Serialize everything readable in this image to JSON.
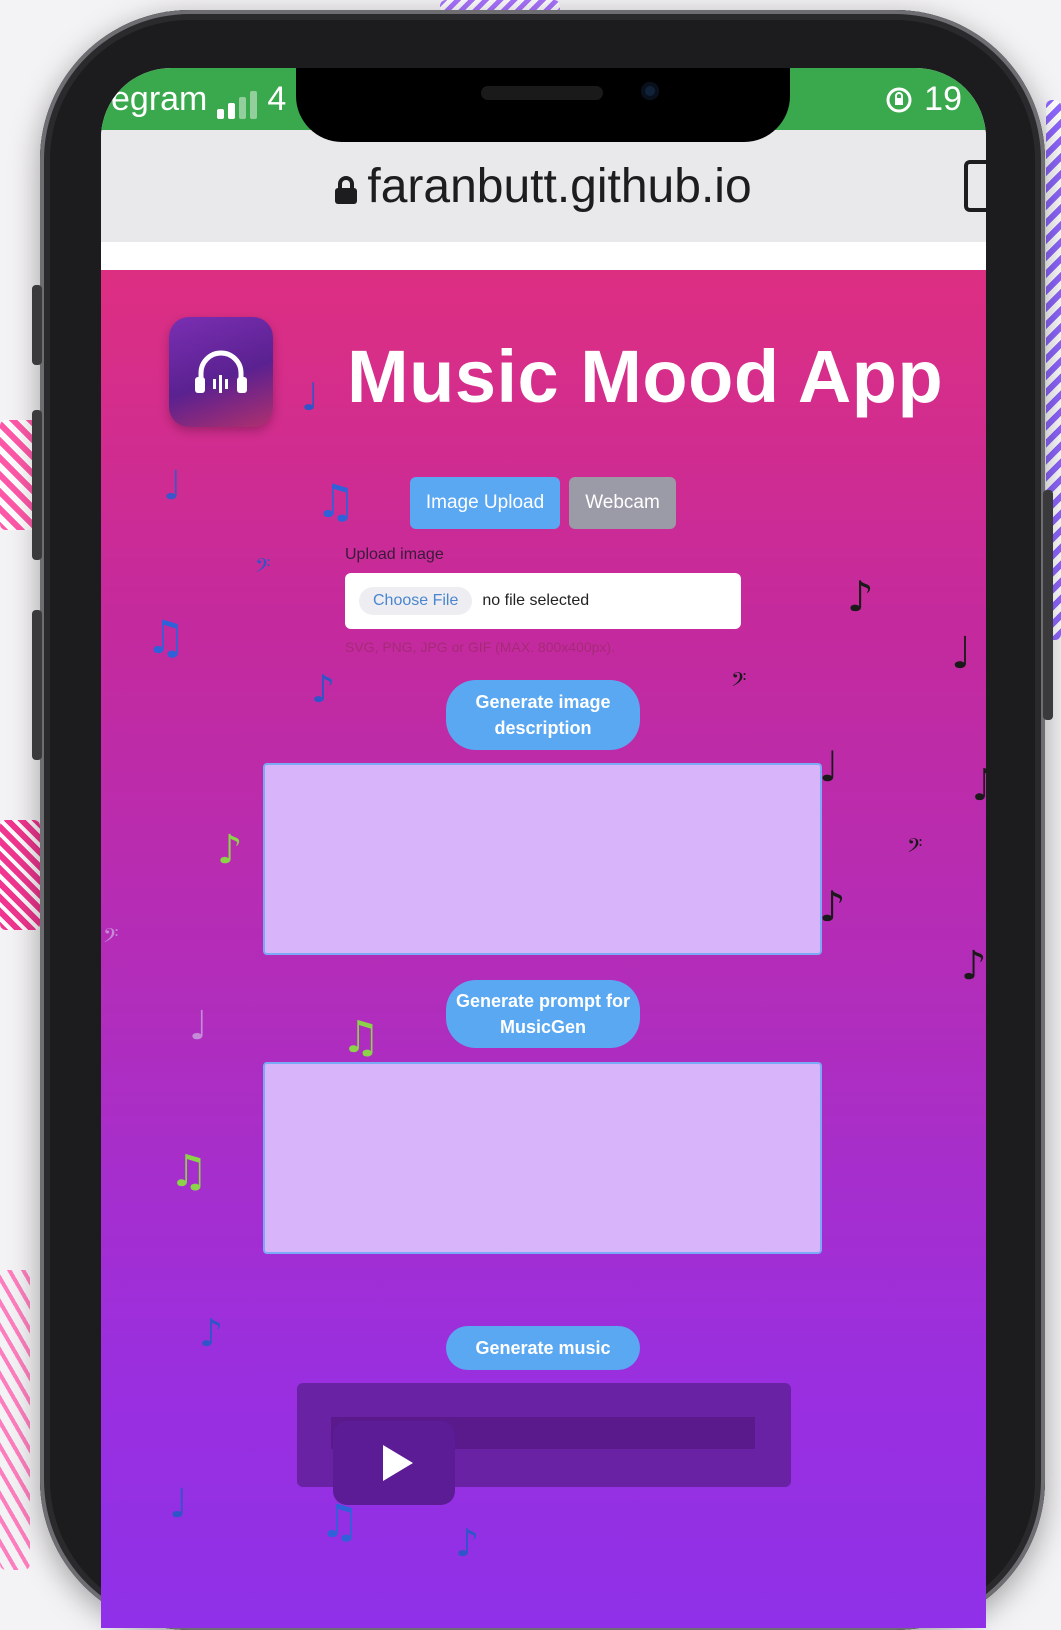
{
  "status_bar": {
    "carrier": "egram",
    "signal_suffix": "4",
    "battery_text": "19"
  },
  "browser": {
    "url": "faranbutt.github.io"
  },
  "app": {
    "title": "Music Mood App",
    "tabs": [
      {
        "label": "Image Upload",
        "active": true
      },
      {
        "label": "Webcam",
        "active": false
      }
    ],
    "upload_label": "Upload image",
    "file_input": {
      "button_label": "Choose File",
      "status": "no file selected"
    },
    "hint": "SVG, PNG, JPG or GIF (MAX. 800x400px).",
    "buttons": {
      "generate_description": "Generate image description",
      "generate_prompt": "Generate prompt for MusicGen",
      "generate_music": "Generate music"
    },
    "description_text": "",
    "prompt_text": ""
  },
  "colors": {
    "status_green": "#3aa84c",
    "gradient_top": "#dd2f82",
    "gradient_bottom": "#8f30e8",
    "button_blue": "#5aa7f2",
    "textarea_fill": "#d8b4fb"
  }
}
